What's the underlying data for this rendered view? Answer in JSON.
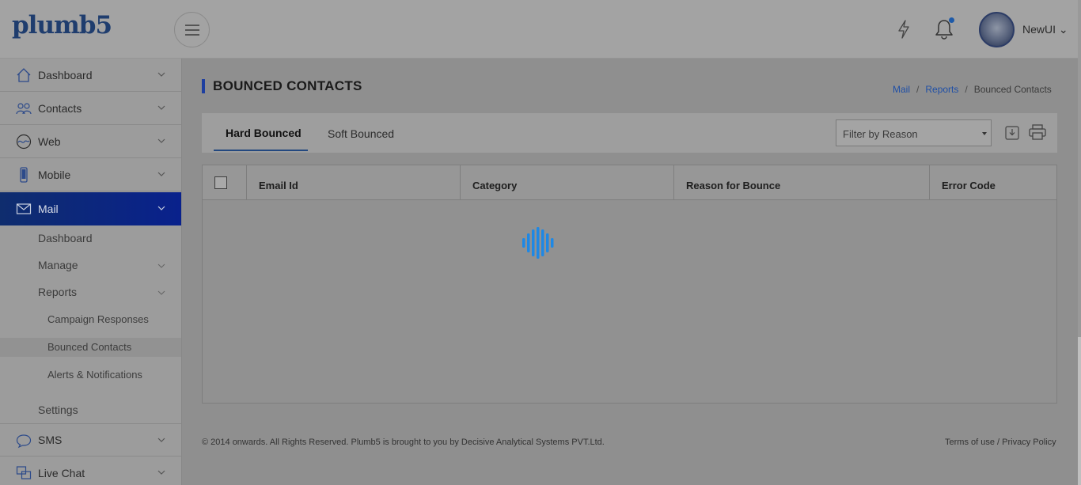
{
  "header": {
    "logo_text": "plumb5",
    "menu_icon": "hamburger-icon",
    "quick_icon": "bolt-icon",
    "notification_icon": "bell-icon",
    "user_name": "NewUI ⌄"
  },
  "sidebar": {
    "items": [
      {
        "label": "Dashboard",
        "icon": "home-icon"
      },
      {
        "label": "Contacts",
        "icon": "contacts-icon"
      },
      {
        "label": "Web",
        "icon": "web-icon"
      },
      {
        "label": "Mobile",
        "icon": "mobile-icon"
      },
      {
        "label": "Mail",
        "icon": "mail-icon"
      },
      {
        "label": "SMS",
        "icon": "sms-icon"
      },
      {
        "label": "Live Chat",
        "icon": "chat-icon"
      }
    ],
    "mail_sub": {
      "dashboard": "Dashboard",
      "manage": "Manage",
      "reports": "Reports",
      "settings": "Settings",
      "reports_sub": [
        "Campaign Responses",
        "Bounced Contacts",
        "Alerts & Notifications"
      ]
    }
  },
  "page": {
    "title": "BOUNCED CONTACTS",
    "breadcrumb": [
      "Mail",
      "Reports",
      "Bounced Contacts"
    ],
    "breadcrumb_sep": "/"
  },
  "tabs": {
    "hard": "Hard Bounced",
    "soft": "Soft Bounced"
  },
  "filter": {
    "placeholder": "Filter by Reason"
  },
  "table": {
    "columns": [
      "Email Id",
      "Category",
      "Reason for Bounce",
      "Error Code"
    ]
  },
  "footer": {
    "copyright": "© 2014 onwards. All Rights Reserved. Plumb5 is brought to you by Decisive Analytical Systems PVT.Ltd.",
    "terms": "Terms of use",
    "divider": "/",
    "privacy": "Privacy Policy"
  },
  "colors": {
    "accent": "#1e3fa0",
    "active_nav": "#09218c",
    "loader": "#1e88e5"
  }
}
